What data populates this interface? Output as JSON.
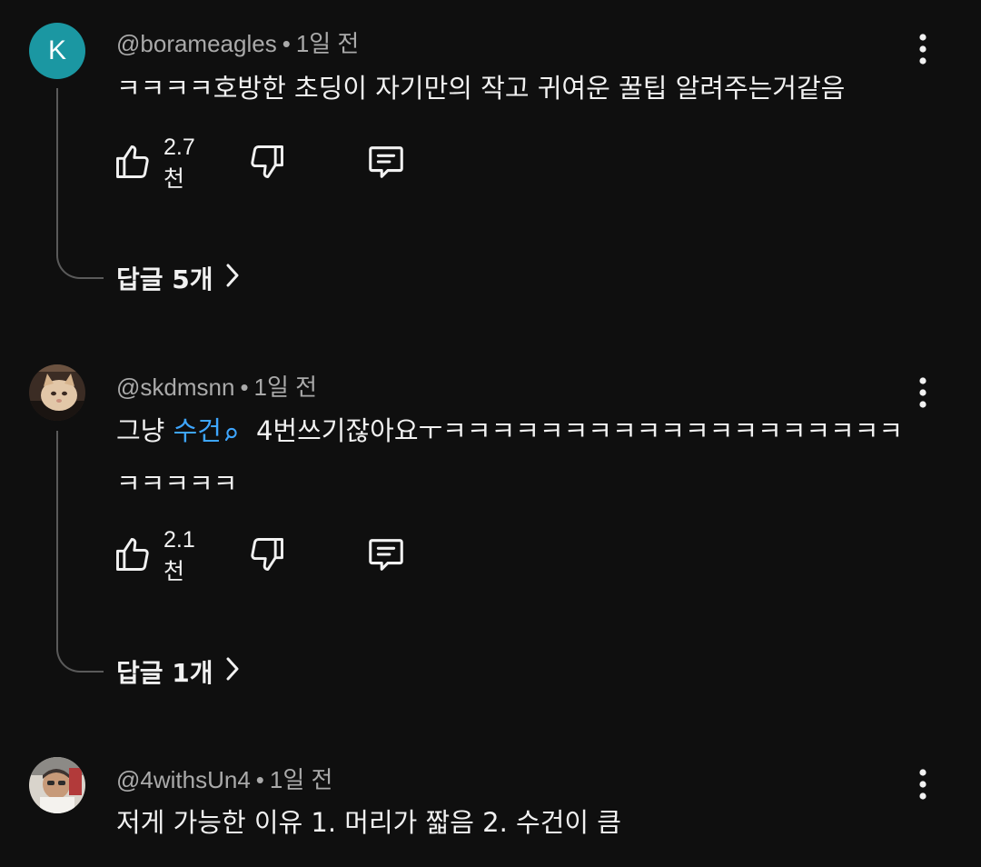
{
  "comments": [
    {
      "avatar_letter": "K",
      "avatar_color": "#1b97a2",
      "handle": "@borameagles",
      "time": "1일 전",
      "text": "ㅋㅋㅋㅋ호방한 초딩이 자기만의 작고 귀여운 꿀팁 알려주는거같음",
      "likes": "2.7천",
      "replies_label": "답글 5개"
    },
    {
      "avatar_image": "cat-photo-avatar",
      "handle": "@skdmsnn",
      "time": "1일 전",
      "text_before": "그냥 ",
      "text_link": "수건",
      "text_after": "4번쓰기잖아요ㅜㅋㅋㅋㅋㅋㅋㅋㅋㅋㅋㅋㅋㅋㅋㅋㅋㅋㅋㅋㅋㅋㅋㅋㅋ",
      "likes": "2.1천",
      "replies_label": "답글 1개"
    },
    {
      "avatar_image": "person-photo-avatar",
      "handle": "@4withsUn4",
      "time": "1일 전",
      "text": "저게 가능한 이유 1. 머리가 짧음 2. 수건이 큼"
    }
  ],
  "separator": "•",
  "colors": {
    "background": "#0f0f0f",
    "link": "#3ea6ff",
    "meta": "#aaaaaa"
  }
}
